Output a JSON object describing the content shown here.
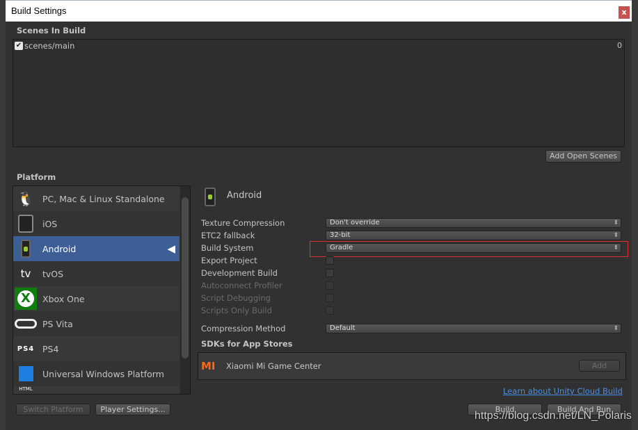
{
  "window": {
    "title": "Build Settings",
    "close_label": "x"
  },
  "scenes": {
    "header": "Scenes In Build",
    "items": [
      {
        "name": "scenes/main",
        "index": "0",
        "checked": true
      }
    ],
    "add_open_scenes": "Add Open Scenes"
  },
  "platform": {
    "header": "Platform",
    "items": [
      {
        "label": "PC, Mac & Linux Standalone",
        "icon": "pc-mac-linux-icon"
      },
      {
        "label": "iOS",
        "icon": "ios-devices-icon"
      },
      {
        "label": "Android",
        "icon": "android-phone-icon",
        "selected": true,
        "active": true
      },
      {
        "label": "tvOS",
        "icon": "apple-tv-icon"
      },
      {
        "label": "Xbox One",
        "icon": "xbox-icon"
      },
      {
        "label": "PS Vita",
        "icon": "ps-vita-icon"
      },
      {
        "label": "PS4",
        "icon": "ps4-icon"
      },
      {
        "label": "Universal Windows Platform",
        "icon": "windows-icon"
      },
      {
        "label": "",
        "icon": "html5-icon"
      }
    ],
    "switch_platform": "Switch Platform",
    "player_settings": "Player Settings..."
  },
  "settings": {
    "platform_title": "Android",
    "texture_compression": {
      "label": "Texture Compression",
      "value": "Don't override"
    },
    "etc2_fallback": {
      "label": "ETC2 fallback",
      "value": "32-bit"
    },
    "build_system": {
      "label": "Build System",
      "value": "Gradle"
    },
    "export_project": {
      "label": "Export Project",
      "checked": false
    },
    "development_build": {
      "label": "Development Build",
      "checked": false
    },
    "autoconnect_profiler": {
      "label": "Autoconnect Profiler",
      "checked": false,
      "disabled": true
    },
    "script_debugging": {
      "label": "Script Debugging",
      "checked": false,
      "disabled": true
    },
    "scripts_only_build": {
      "label": "Scripts Only Build",
      "checked": false,
      "disabled": true
    },
    "compression_method": {
      "label": "Compression Method",
      "value": "Default"
    },
    "sdks_header": "SDKs for App Stores",
    "sdk": {
      "name": "Xiaomi Mi Game Center",
      "add": "Add"
    },
    "cloud_link": "Learn about Unity Cloud Build",
    "build": "Build",
    "build_and_run": "Build And Run"
  },
  "watermark": "https://blog.csdn.net/LN_Polaris",
  "colors": {
    "selection": "#3e5f96",
    "highlight_box": "#e03030",
    "link": "#4a8fe7",
    "close": "#c75050"
  }
}
